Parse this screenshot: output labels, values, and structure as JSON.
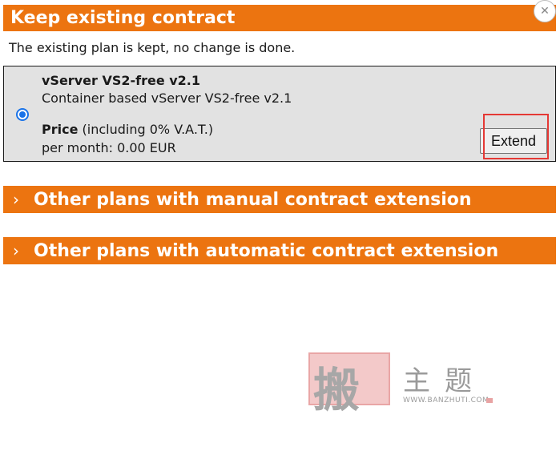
{
  "keep_section": {
    "title": "Keep existing contract",
    "description": "The existing plan is kept, no change is done."
  },
  "close_button": {
    "icon": "close-icon",
    "glyph": "✕"
  },
  "plan": {
    "name": "vServer VS2-free v2.1",
    "description": "Container based vServer VS2-free v2.1",
    "price_label": "Price",
    "price_note": " (including 0% V.A.T.)",
    "per_month": "per month: 0.00 EUR",
    "selected": true,
    "extend_label": "Extend"
  },
  "sections": {
    "manual": {
      "chevron": "›",
      "title": "Other plans with manual contract extension"
    },
    "automatic": {
      "chevron": "›",
      "title": "Other plans with automatic contract extension"
    }
  },
  "watermark": {
    "seal_text": "搬",
    "text": "主题",
    "url": "WWW.BANZHUTI.COM"
  },
  "colors": {
    "accent": "#ec7410",
    "highlight": "#e53935",
    "radio": "#1a73e8",
    "plan_bg": "#e2e2e2"
  }
}
